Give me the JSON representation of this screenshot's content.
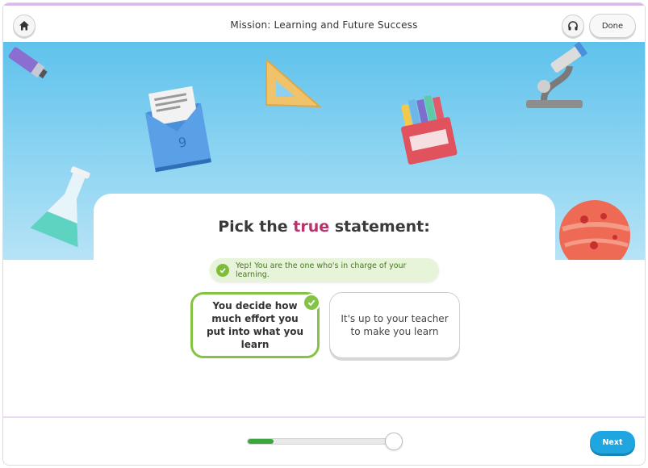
{
  "header": {
    "title": "Mission: Learning and Future Success",
    "done_label": "Done",
    "home_icon": "home-icon",
    "audio_icon": "headphones-icon"
  },
  "question": {
    "prompt_before": "Pick the ",
    "prompt_highlight": "true",
    "prompt_after": " statement:",
    "highlight_color": "#b8336a"
  },
  "feedback": {
    "text": "Yep! You are the one who's in charge of your learning.",
    "icon": "check-circle-icon",
    "color": "#7dbd3a"
  },
  "options": [
    {
      "label": "You decide how much effort you put into what you learn",
      "state": "correct-selected"
    },
    {
      "label": "It's up to your teacher to make you learn",
      "state": "unselected"
    }
  ],
  "progress": {
    "fraction": 0.17,
    "color": "#3aa63d"
  },
  "footer": {
    "next_label": "Next",
    "next_color": "#1fa6e0"
  },
  "decorations": [
    "marker-icon",
    "envelope-icon",
    "ruler-triangle-icon",
    "crayon-box-icon",
    "microscope-icon",
    "flask-icon",
    "planet-icon"
  ]
}
